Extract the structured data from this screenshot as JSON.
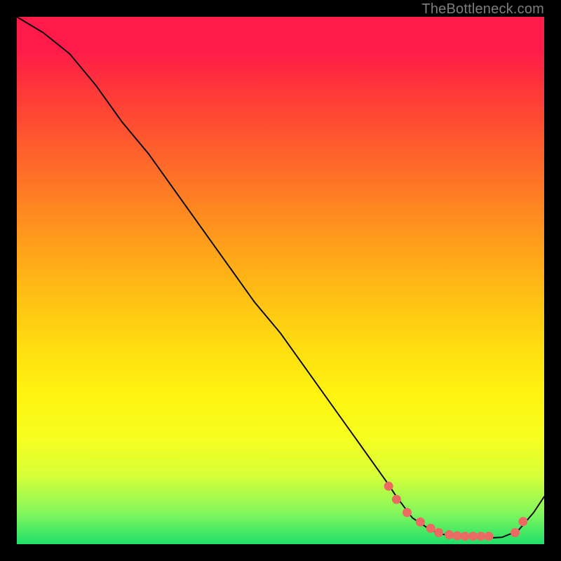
{
  "watermark": "TheBottleneck.com",
  "chart_data": {
    "type": "line",
    "title": "",
    "xlabel": "",
    "ylabel": "",
    "xlim": [
      0,
      100
    ],
    "ylim": [
      0,
      100
    ],
    "series": [
      {
        "name": "curve",
        "x": [
          0,
          5,
          10,
          15,
          20,
          25,
          30,
          35,
          40,
          45,
          50,
          55,
          60,
          65,
          70,
          72,
          75,
          78,
          80,
          83,
          85,
          88,
          90,
          92,
          95,
          98,
          100
        ],
        "values": [
          100,
          97,
          93,
          87,
          80,
          74,
          67,
          60,
          53,
          46,
          40,
          33,
          26,
          19,
          12,
          9,
          5,
          3,
          2,
          1.5,
          1.3,
          1.2,
          1.2,
          1.3,
          2.5,
          6,
          9
        ]
      },
      {
        "name": "dots",
        "x": [
          70.5,
          72,
          74,
          76.5,
          78.5,
          80,
          82,
          83.5,
          85,
          86.5,
          88,
          89.5,
          94.5,
          96
        ],
        "values": [
          11,
          8.5,
          6,
          4.2,
          3,
          2.2,
          1.8,
          1.6,
          1.5,
          1.5,
          1.5,
          1.5,
          2.2,
          4.3
        ]
      }
    ],
    "colors": {
      "curve": "#000000",
      "dots": "#eb6b63"
    }
  }
}
